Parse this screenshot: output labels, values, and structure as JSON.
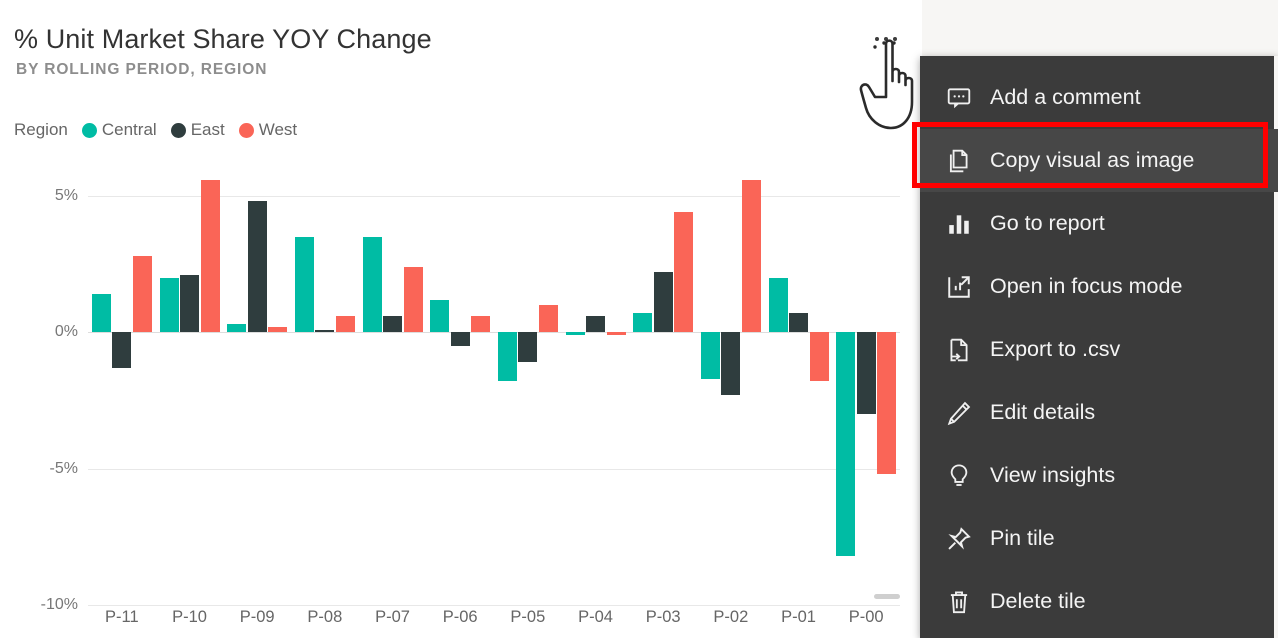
{
  "tile": {
    "title": "% Unit Market Share YOY Change",
    "subtitle": "BY ROLLING PERIOD, REGION",
    "more_options_label": "..."
  },
  "legend": {
    "title": "Region",
    "items": [
      {
        "label": "Central",
        "color": "#00bca4"
      },
      {
        "label": "East",
        "color": "#2f3d3e"
      },
      {
        "label": "West",
        "color": "#fa6557"
      }
    ]
  },
  "context_menu": {
    "items": [
      {
        "label": "Add a comment",
        "icon": "comment-icon",
        "highlighted": false
      },
      {
        "label": "Copy visual as image",
        "icon": "copy-icon",
        "highlighted": true
      },
      {
        "label": "Go to report",
        "icon": "bar-chart-icon",
        "highlighted": false
      },
      {
        "label": "Open in focus mode",
        "icon": "focus-mode-icon",
        "highlighted": false
      },
      {
        "label": "Export to .csv",
        "icon": "export-file-icon",
        "highlighted": false
      },
      {
        "label": "Edit details",
        "icon": "pencil-icon",
        "highlighted": false
      },
      {
        "label": "View insights",
        "icon": "lightbulb-icon",
        "highlighted": false
      },
      {
        "label": "Pin tile",
        "icon": "pin-icon",
        "highlighted": false
      },
      {
        "label": "Delete tile",
        "icon": "trash-icon",
        "highlighted": false
      }
    ],
    "highlight_color": "#ff0000"
  },
  "chart_data": {
    "type": "bar",
    "title": "% Unit Market Share YOY Change",
    "subtitle": "BY ROLLING PERIOD, REGION",
    "xlabel": "",
    "ylabel": "",
    "ylim": [
      -10,
      6.5
    ],
    "grid": true,
    "legend_position": "top-left",
    "y_ticks": [
      5,
      0,
      -5,
      -10
    ],
    "y_tick_labels": [
      "5%",
      "0%",
      "-5%",
      "-10%"
    ],
    "categories": [
      "P-11",
      "P-10",
      "P-09",
      "P-08",
      "P-07",
      "P-06",
      "P-05",
      "P-04",
      "P-03",
      "P-02",
      "P-01",
      "P-00"
    ],
    "series": [
      {
        "name": "Central",
        "color": "#00bca4",
        "values": [
          1.4,
          2.0,
          0.3,
          3.5,
          3.5,
          1.2,
          -1.8,
          -0.1,
          0.7,
          -1.7,
          2.0,
          -8.2
        ]
      },
      {
        "name": "East",
        "color": "#2f3d3e",
        "values": [
          -1.3,
          2.1,
          4.8,
          0.1,
          0.6,
          -0.5,
          -1.1,
          0.6,
          2.2,
          -2.3,
          0.7,
          -3.0
        ]
      },
      {
        "name": "West",
        "color": "#fa6557",
        "values": [
          2.8,
          5.6,
          0.2,
          0.6,
          2.4,
          0.6,
          1.0,
          -0.1,
          4.4,
          5.6,
          -1.8,
          -5.2
        ]
      }
    ]
  }
}
